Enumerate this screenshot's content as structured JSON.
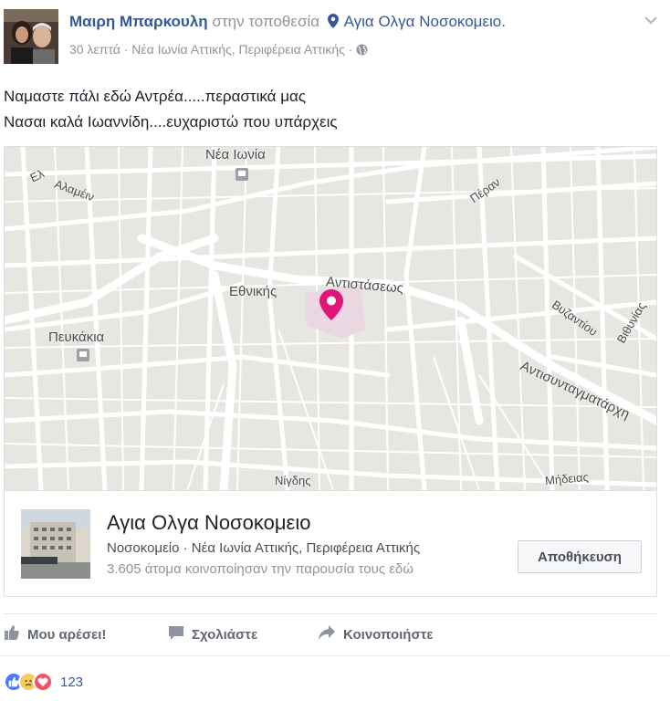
{
  "post": {
    "author": "Μαιρη Μπαρκουλη",
    "at_text": "στην τοποθεσία",
    "place": "Αγια Ολγα Νοσοκομειο.",
    "time": "30 λεπτά",
    "location": "Νέα Ιωνία Αττικής, Περιφέρεια Αττικής",
    "separator": "·",
    "privacy_icon": "globe-icon",
    "text_lines": [
      "Ναμαστε πάλι εδώ Αντρέα.....περαστικά μας",
      "Νασαι καλά Ιωαννίδη....ευχαριστώ που υπάρχεις"
    ]
  },
  "map": {
    "labels": {
      "nea_ionia": "Νέα Ιωνία",
      "alamein": "Αλαμέιν",
      "el": "Ελ",
      "perask": "Πέραν",
      "ethnikis": "Εθνικής",
      "antistaseos": "Αντιστάσεως",
      "pefkakia": "Πευκάκια",
      "vyzantiou": "Βυζαντίου",
      "vithynias": "Βιθυνίας",
      "antisyntagmatarchi": "Αντισυνταγματάρχη",
      "nigdis": "Νίγδης",
      "mideias": "Μήδειας"
    },
    "pin_color": "#e0147a"
  },
  "place_card": {
    "title": "Αγια Ολγα Νοσοκομειο",
    "category": "Νοσοκομείο",
    "location": "Νέα Ιωνία Αττικής, Περιφέρεια Αττικής",
    "count_text": "3.605 άτομα κοινοποίησαν την παρουσία τους εδώ",
    "save_label": "Αποθήκευση"
  },
  "actions": {
    "like": "Μου αρέσει!",
    "comment": "Σχολιάστε",
    "share": "Κοινοποιήστε"
  },
  "reactions": {
    "icons": [
      "like-icon",
      "sad-icon",
      "love-icon"
    ],
    "count": "123"
  },
  "colors": {
    "link": "#365899",
    "muted": "#90949c",
    "text": "#1d2129"
  }
}
